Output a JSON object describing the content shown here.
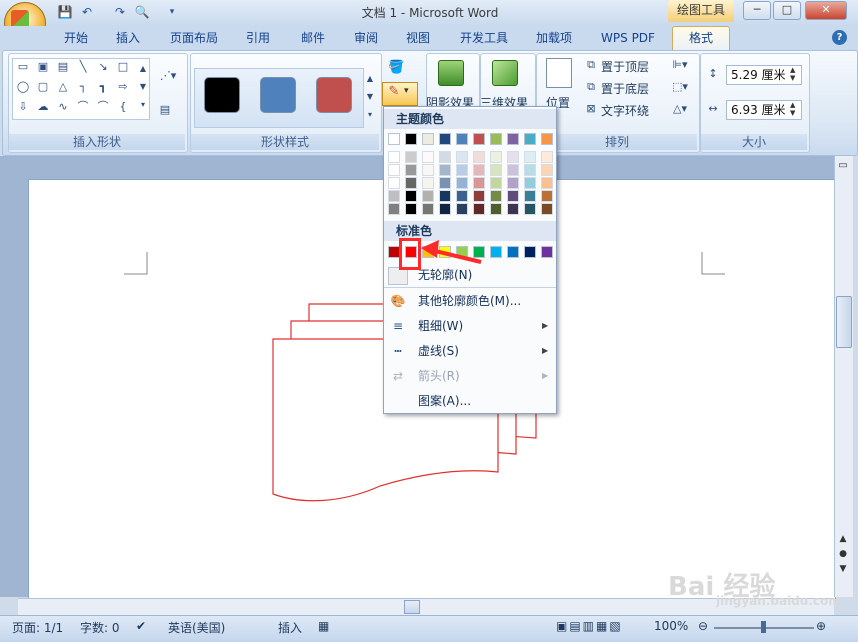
{
  "window": {
    "title": "文档 1 - Microsoft Word",
    "context_tab": "绘图工具",
    "controls": [
      "─",
      "□",
      "✕"
    ]
  },
  "quick_access": [
    "save-icon",
    "undo-icon",
    "redo-icon",
    "print-preview-icon",
    "customize-icon"
  ],
  "tabs": [
    "开始",
    "插入",
    "页面布局",
    "引用",
    "邮件",
    "审阅",
    "视图",
    "开发工具",
    "加载项",
    "WPS PDF",
    "格式"
  ],
  "active_tab": "格式",
  "help": "?",
  "ribbon": {
    "insert_shapes": {
      "label": "插入形状"
    },
    "shape_styles": {
      "label": "形状样式",
      "swatches": [
        "#000000",
        "#4f81bd",
        "#c0504d"
      ]
    },
    "shadow": {
      "label": "阴影效果"
    },
    "threed": {
      "label": "三维效果"
    },
    "arrange": {
      "label": "排列",
      "position": "位置",
      "bring_front": "置于顶层",
      "send_back": "置于底层",
      "text_wrap": "文字环绕"
    },
    "size": {
      "label": "大小",
      "height": "5.29 厘米",
      "width": "6.93 厘米"
    }
  },
  "menu": {
    "theme_colors_label": "主题颜色",
    "theme_colors": [
      "#ffffff",
      "#000000",
      "#eeece1",
      "#1f497d",
      "#4f81bd",
      "#c0504d",
      "#9bbb59",
      "#8064a2",
      "#4bacc6",
      "#f79646"
    ],
    "standard_colors_label": "标准色",
    "standard_colors": [
      "#c00000",
      "#ff0000",
      "#ffc000",
      "#ffff00",
      "#92d050",
      "#00b050",
      "#00b0f0",
      "#0070c0",
      "#002060",
      "#7030a0"
    ],
    "items": {
      "no_outline": "无轮廓(N)",
      "more_colors": "其他轮廓颜色(M)...",
      "weight": "粗细(W)",
      "dashes": "虚线(S)",
      "arrows": "箭头(R)",
      "pattern": "图案(A)..."
    }
  },
  "statusbar": {
    "page": "页面: 1/1",
    "words": "字数: 0",
    "language": "英语(美国)",
    "mode": "插入",
    "zoom": "100%"
  },
  "watermark": {
    "text": "Bai 经验",
    "url": "jingyan.baidu.com"
  }
}
